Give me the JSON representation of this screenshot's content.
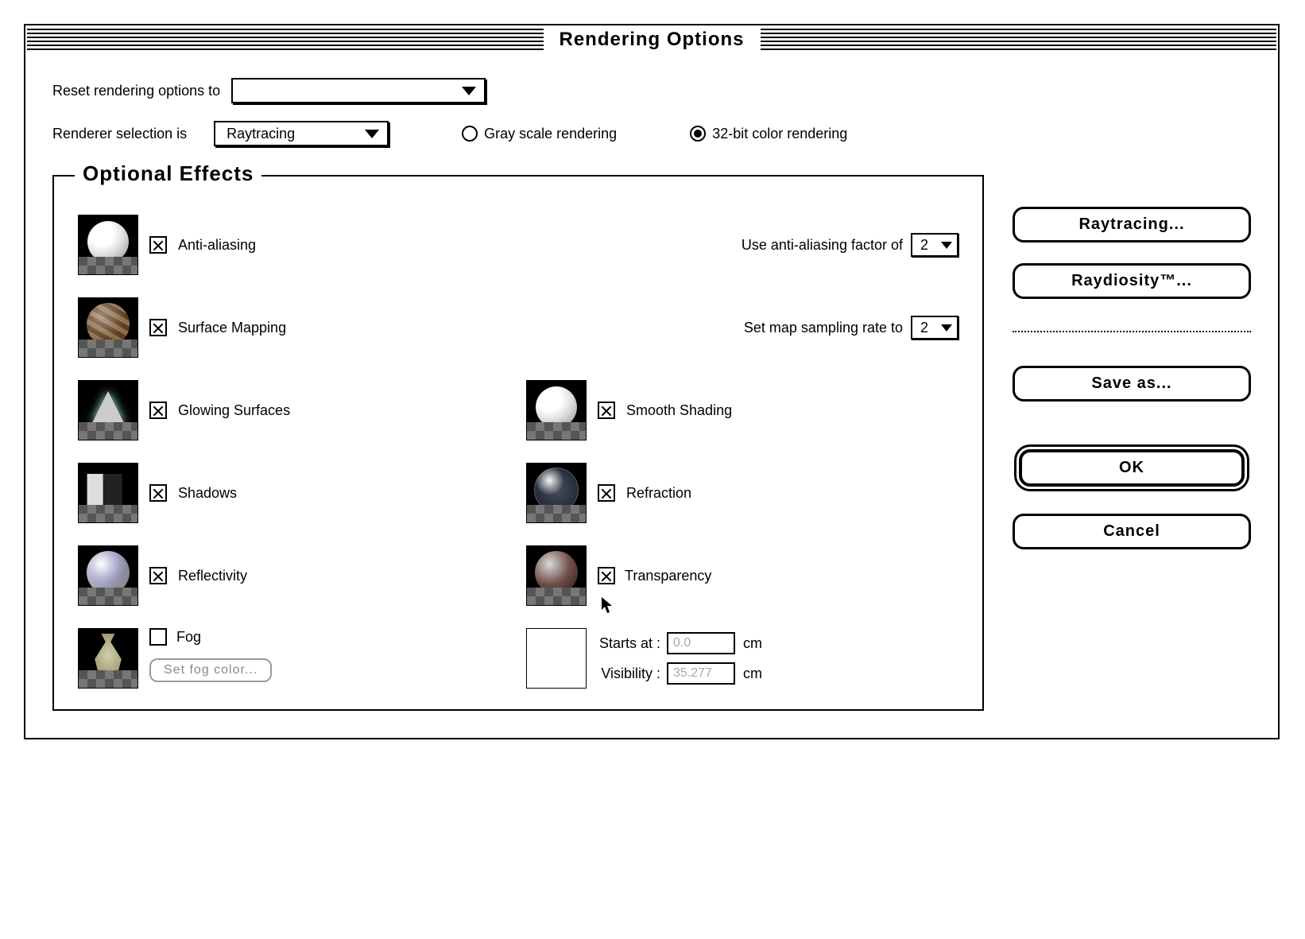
{
  "window": {
    "title": "Rendering Options"
  },
  "top": {
    "reset_label": "Reset rendering options to",
    "reset_value": "",
    "renderer_label": "Renderer selection is",
    "renderer_value": "Raytracing",
    "mode_gray": "Gray scale rendering",
    "mode_color": "32-bit color rendering",
    "mode_selected": "color"
  },
  "group": {
    "legend": "Optional Effects"
  },
  "effects": {
    "antialias": {
      "label": "Anti-aliasing",
      "checked": true
    },
    "surface_map": {
      "label": "Surface Mapping",
      "checked": true
    },
    "glow": {
      "label": "Glowing Surfaces",
      "checked": true
    },
    "smooth": {
      "label": "Smooth Shading",
      "checked": true
    },
    "shadows": {
      "label": "Shadows",
      "checked": true
    },
    "refraction": {
      "label": "Refraction",
      "checked": true
    },
    "reflectivity": {
      "label": "Reflectivity",
      "checked": true
    },
    "transparency": {
      "label": "Transparency",
      "checked": true
    },
    "fog": {
      "label": "Fog",
      "checked": false
    }
  },
  "params": {
    "aa_label": "Use anti-aliasing factor of",
    "aa_value": "2",
    "map_label": "Set map sampling rate to",
    "map_value": "2",
    "fog_color_btn": "Set fog color...",
    "fog_starts_label": "Starts at :",
    "fog_starts_value": "0.0",
    "fog_vis_label": "Visibility :",
    "fog_vis_value": "35.277",
    "unit": "cm"
  },
  "sidebar": {
    "raytracing": "Raytracing...",
    "raydiosity": "Raydiosity™...",
    "saveas": "Save as...",
    "ok": "OK",
    "cancel": "Cancel"
  }
}
